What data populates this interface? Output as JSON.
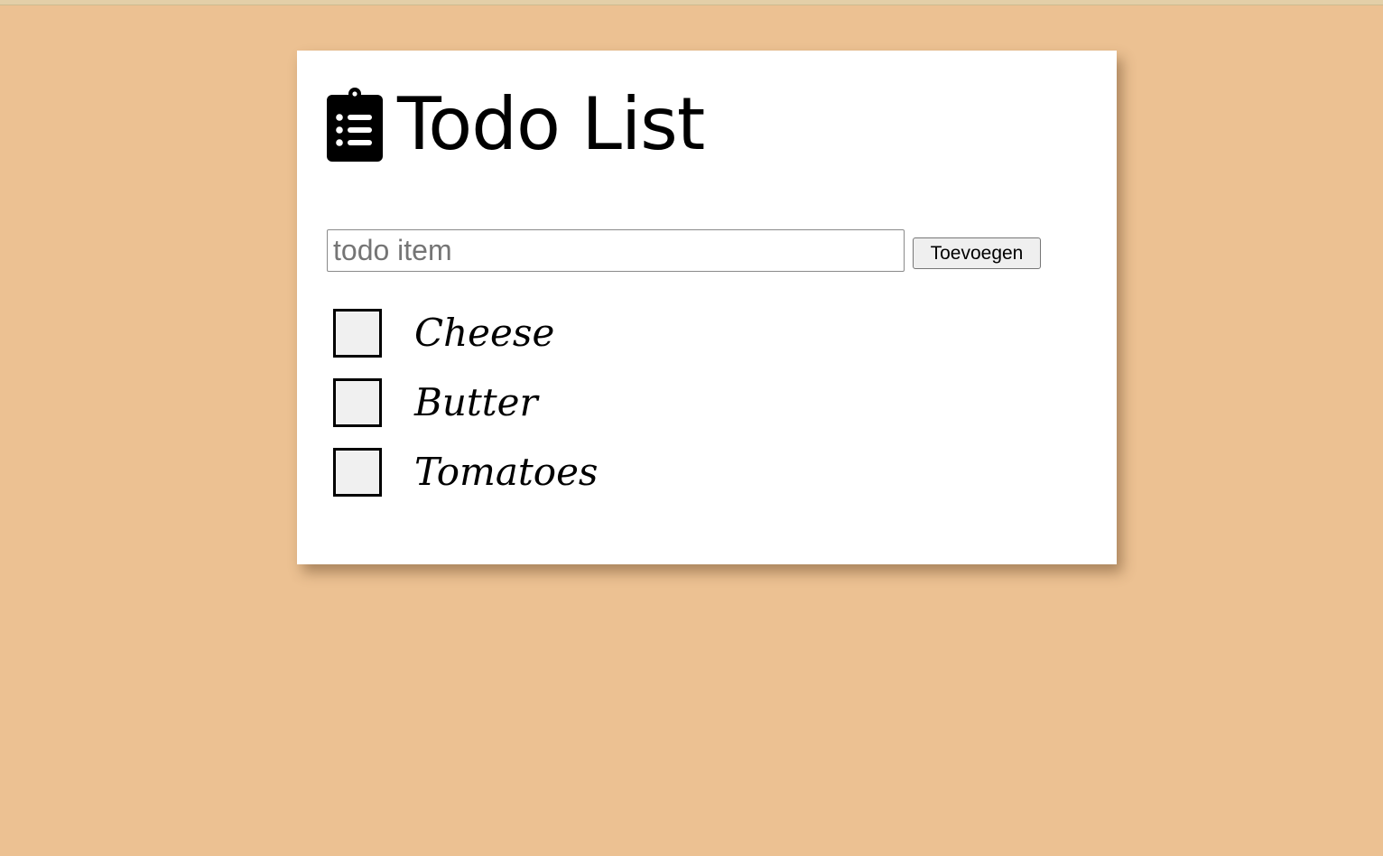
{
  "app": {
    "title": "Todo List",
    "icon": "clipboard-list-icon"
  },
  "form": {
    "input_value": "",
    "input_placeholder": "todo item",
    "add_button_label": "Toevoegen"
  },
  "todos": [
    {
      "label": "Cheese",
      "checked": false
    },
    {
      "label": "Butter",
      "checked": false
    },
    {
      "label": "Tomatoes",
      "checked": false
    }
  ],
  "colors": {
    "background": "#ecc192",
    "card": "#ffffff",
    "text": "#000000",
    "checkbox_fill": "#f0f0f0"
  }
}
